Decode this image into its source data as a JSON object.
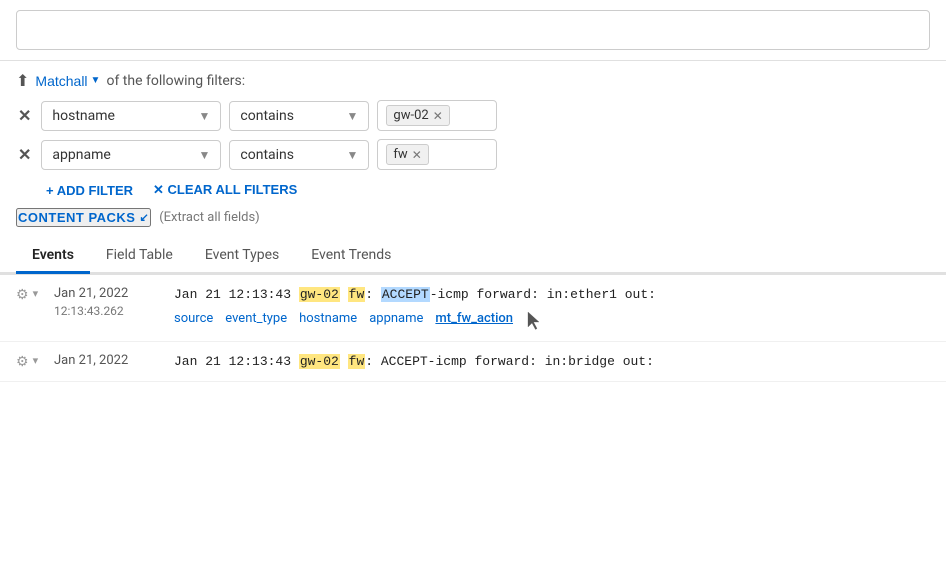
{
  "search": {
    "placeholder": "",
    "value": ""
  },
  "filters": {
    "match_icon": "⬆",
    "match_label": "Matchall",
    "match_suffix": "of the following filters:",
    "rows": [
      {
        "id": "filter-1",
        "field": "hostname",
        "operator": "contains",
        "tag": "gw-02"
      },
      {
        "id": "filter-2",
        "field": "appname",
        "operator": "contains",
        "tag": "fw"
      }
    ],
    "add_label": "+ ADD FILTER",
    "clear_label": "✕ CLEAR ALL FILTERS"
  },
  "content_packs": {
    "label": "CONTENT PACKS",
    "chevron": "↙",
    "sub": "(Extract all fields)"
  },
  "tabs": [
    {
      "id": "events",
      "label": "Events",
      "active": true
    },
    {
      "id": "field-table",
      "label": "Field Table",
      "active": false
    },
    {
      "id": "event-types",
      "label": "Event Types",
      "active": false
    },
    {
      "id": "event-trends",
      "label": "Event Trends",
      "active": false
    }
  ],
  "events": [
    {
      "date": "Jan 21, 2022",
      "time": "12:13:43.262",
      "message_parts": [
        {
          "text": "Jan 21  12:13:43 ",
          "style": "normal"
        },
        {
          "text": "gw-02",
          "style": "yellow"
        },
        {
          "text": " ",
          "style": "normal"
        },
        {
          "text": "fw",
          "style": "yellow"
        },
        {
          "text": ": ",
          "style": "normal"
        },
        {
          "text": "ACCEPT",
          "style": "blue"
        },
        {
          "text": "-icmp forward: in:ether1 out:",
          "style": "normal"
        }
      ],
      "fields": [
        {
          "label": "source",
          "type": "link"
        },
        {
          "label": "event_type",
          "type": "link"
        },
        {
          "label": "hostname",
          "type": "link"
        },
        {
          "label": "appname",
          "type": "link"
        },
        {
          "label": "mt_fw_action",
          "type": "link-underlined"
        }
      ]
    },
    {
      "date": "Jan 21, 2022",
      "time": "",
      "message_parts": [
        {
          "text": "Jan 21  12:13:43 ",
          "style": "normal"
        },
        {
          "text": "gw-02",
          "style": "yellow"
        },
        {
          "text": " ",
          "style": "normal"
        },
        {
          "text": "fw",
          "style": "yellow"
        },
        {
          "text": ": ACCEPT-icmp forward: in:bridge out:",
          "style": "normal"
        }
      ],
      "fields": []
    }
  ],
  "colors": {
    "accent": "#0066cc",
    "yellow_highlight": "#ffe680",
    "blue_highlight": "#b3d9ff"
  }
}
